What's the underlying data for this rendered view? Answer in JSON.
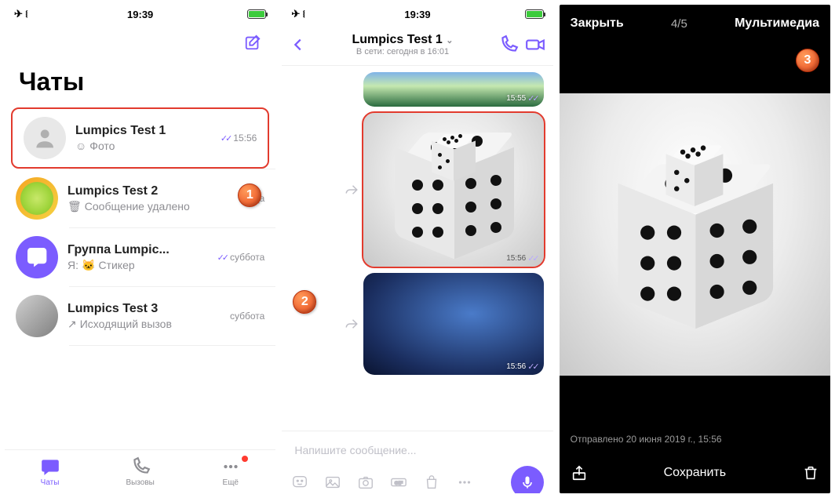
{
  "status_time": "19:39",
  "screen1": {
    "title": "Чаты",
    "chats": [
      {
        "name": "Lumpics Test 1",
        "msg": "Фото",
        "time": "15:56",
        "ticks": true
      },
      {
        "name": "Lumpics Test 2",
        "msg": "Сообщение удалено",
        "time": "среда"
      },
      {
        "name": "Группа Lumpic...",
        "msg": "Я: 🐱 Стикер",
        "time": "суббота",
        "ticks": true,
        "prefix": "Я:"
      },
      {
        "name": "Lumpics Test 3",
        "msg": "Исходящий вызов",
        "time": "суббота"
      }
    ],
    "tabs": {
      "chats": "Чаты",
      "calls": "Вызовы",
      "more": "Ещё"
    }
  },
  "screen2": {
    "contact": "Lumpics Test 1",
    "status": "В сети: сегодня в 16:01",
    "ts1": "15:55",
    "ts2": "15:56",
    "ts3": "15:56",
    "placeholder": "Напишите сообщение..."
  },
  "screen3": {
    "close": "Закрыть",
    "counter": "4/5",
    "media": "Мультимедиа",
    "sent": "Отправлено 20 июня 2019 г., 15:56",
    "save": "Сохранить"
  },
  "badges": {
    "b1": "1",
    "b2": "2",
    "b3": "3"
  }
}
